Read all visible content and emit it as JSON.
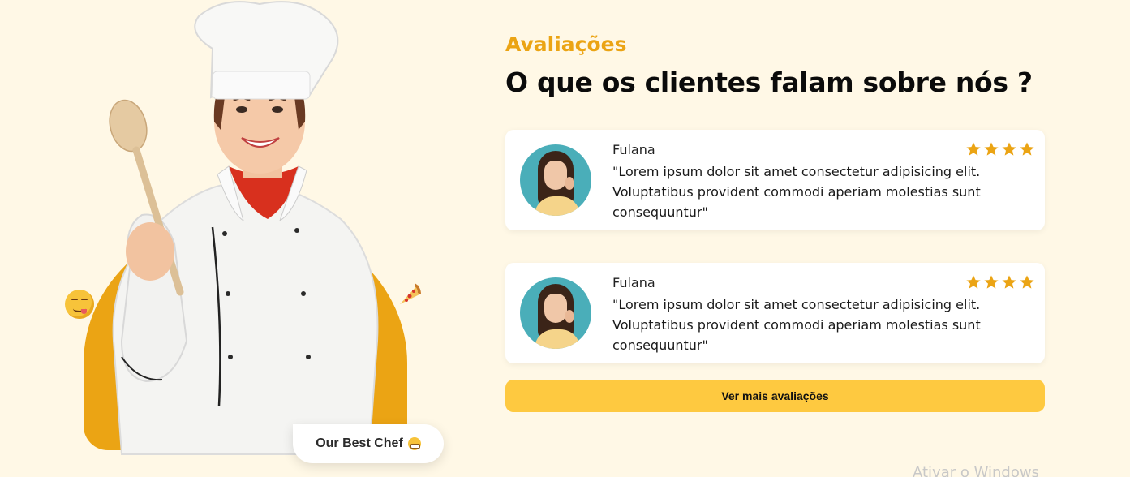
{
  "colors": {
    "background": "#fff8e6",
    "accent": "#eba414",
    "button": "#fec940",
    "star": "#eba414"
  },
  "hero": {
    "badge_text": "Our Best Chef",
    "icons": [
      "smiling-face-icon",
      "pizza-icon",
      "grinning-face-icon"
    ]
  },
  "section": {
    "label": "Avaliações",
    "title": "O que os clientes falam sobre nós ?"
  },
  "reviews": [
    {
      "name": "Fulana",
      "rating": 4,
      "text": "\"Lorem ipsum dolor sit amet consectetur adipisicing elit. Voluptatibus provident commodi aperiam molestias sunt consequuntur\""
    },
    {
      "name": "Fulana",
      "rating": 4,
      "text": "\"Lorem ipsum dolor sit amet consectetur adipisicing elit. Voluptatibus provident commodi aperiam molestias sunt consequuntur\""
    }
  ],
  "more_button_label": "Ver mais avaliações",
  "os_watermark": "Ativar o Windows"
}
